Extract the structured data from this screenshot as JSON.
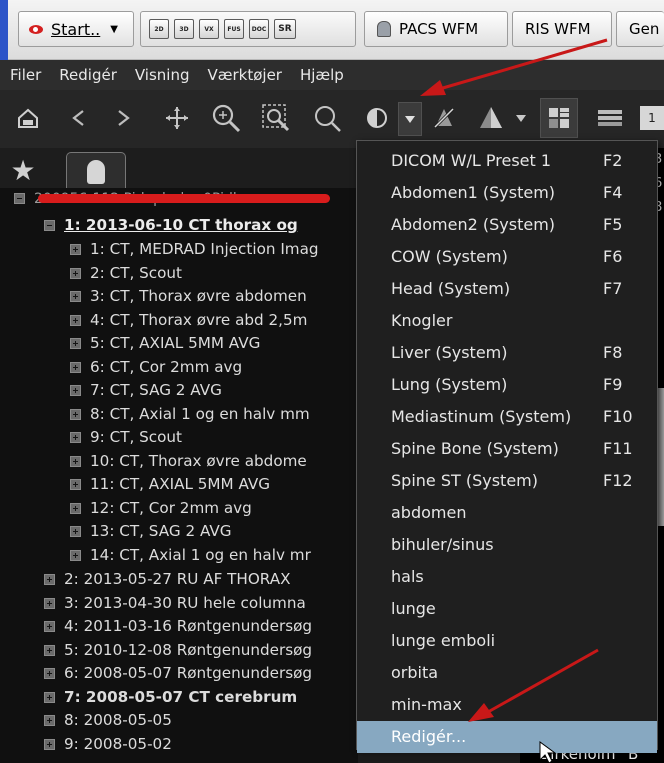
{
  "taskbar": {
    "start_label": "Start..",
    "mini_buttons": [
      "2D",
      "3D",
      "VX",
      "FUS",
      "DOC",
      "SR"
    ],
    "pacs_label": "PACS WFM",
    "ris_label": "RIS WFM",
    "gen_label": "Gen"
  },
  "menubar": {
    "items": [
      "Filer",
      "Redigér",
      "Visning",
      "Værktøjer",
      "Hjælp"
    ]
  },
  "toolbar": {
    "icons": [
      "home-icon",
      "back-icon",
      "forward-icon",
      "pan-icon",
      "zoom-in-icon",
      "zoom-box-icon",
      "magnifier-icon",
      "window-level-icon",
      "dropdown-arrow-icon",
      "invert-icon",
      "cone-icon",
      "cone-dropdown-icon",
      "layout-grid-icon",
      "stack-icon"
    ],
    "last_button": "1"
  },
  "tree": {
    "patient_row": "200956-112 Pidaph der 0Pidh",
    "open_study": "1: 2013-06-10 CT thorax og",
    "series": [
      "1: CT, MEDRAD Injection Imag",
      "2: CT, Scout",
      "3: CT, Thorax øvre abdomen",
      "4: CT, Thorax øvre abd 2,5m",
      "5: CT, AXIAL 5MM AVG",
      "6: CT, Cor 2mm avg",
      "7: CT, SAG 2 AVG",
      "8: CT, Axial 1 og en halv mm",
      "9: CT, Scout",
      "10: CT, Thorax øvre abdome",
      "11: CT, AXIAL 5MM AVG",
      "12: CT, Cor 2mm avg",
      "13: CT, SAG 2 AVG",
      "14: CT, Axial 1 og en halv mr"
    ],
    "studies": [
      {
        "label": "2: 2013-05-27 RU AF THORAX",
        "bold": false
      },
      {
        "label": "3: 2013-04-30 RU hele columna",
        "bold": false
      },
      {
        "label": "4: 2011-03-16 Røntgenundersøg",
        "bold": false
      },
      {
        "label": "5: 2010-12-08 Røntgenundersøg",
        "bold": false
      },
      {
        "label": "6: 2008-05-07 Røntgenundersøg",
        "bold": false
      },
      {
        "label": "7: 2008-05-07 CT cerebrum",
        "bold": true
      },
      {
        "label": "8: 2008-05-05",
        "bold": false
      },
      {
        "label": "9: 2008-05-02",
        "bold": false
      }
    ]
  },
  "viewer": {
    "side_chars": [
      "3",
      "6",
      "8"
    ],
    "bottom_label": "Birkeholm^B"
  },
  "dropdown": {
    "items": [
      {
        "label": "DICOM W/L Preset 1",
        "key": "F2"
      },
      {
        "label": "Abdomen1 (System)",
        "key": "F4"
      },
      {
        "label": "Abdomen2 (System)",
        "key": "F5"
      },
      {
        "label": "COW (System)",
        "key": "F6"
      },
      {
        "label": "Head (System)",
        "key": "F7"
      },
      {
        "label": "Knogler",
        "key": ""
      },
      {
        "label": "Liver (System)",
        "key": "F8"
      },
      {
        "label": "Lung (System)",
        "key": "F9"
      },
      {
        "label": "Mediastinum (System)",
        "key": "F10"
      },
      {
        "label": "Spine Bone (System)",
        "key": "F11"
      },
      {
        "label": "Spine ST (System)",
        "key": "F12"
      },
      {
        "label": "abdomen",
        "key": ""
      },
      {
        "label": "bihuler/sinus",
        "key": ""
      },
      {
        "label": "hals",
        "key": ""
      },
      {
        "label": "lunge",
        "key": ""
      },
      {
        "label": "lunge emboli",
        "key": ""
      },
      {
        "label": "orbita",
        "key": ""
      },
      {
        "label": "min-max",
        "key": ""
      },
      {
        "label": "Redigér...",
        "key": ""
      }
    ],
    "highlighted_index": 18
  },
  "colors": {
    "highlight": "#87a8c1",
    "annotation_red": "#d81c1c"
  }
}
